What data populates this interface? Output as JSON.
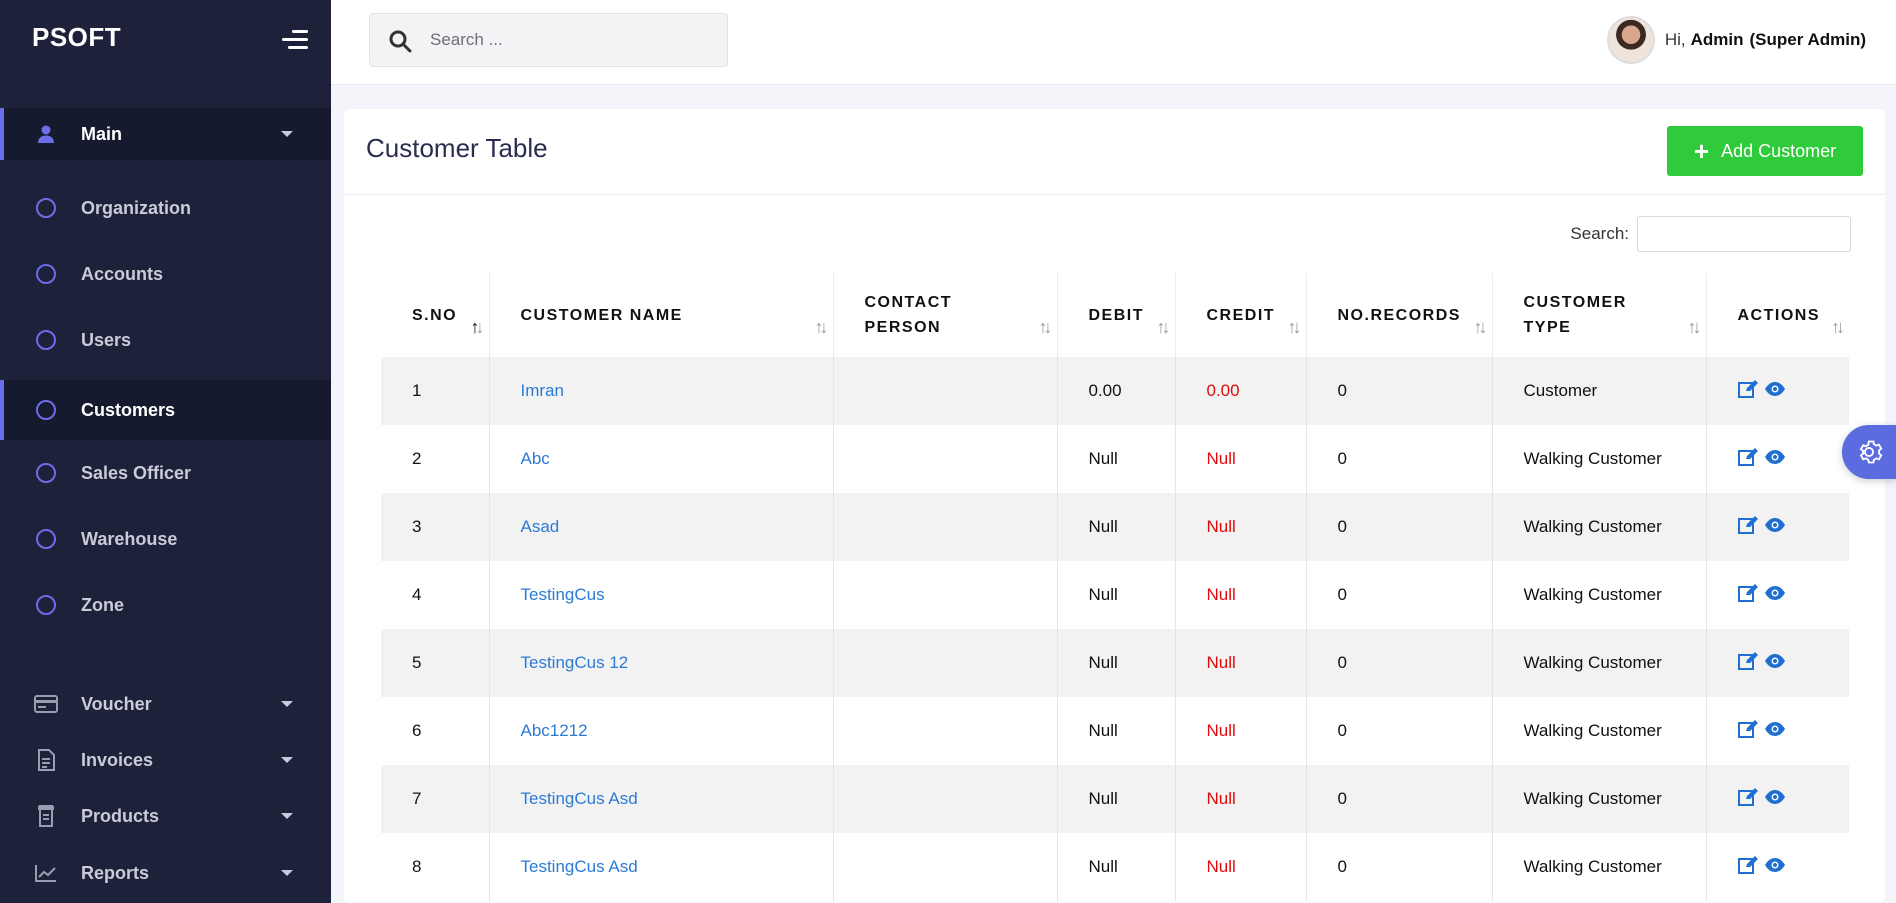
{
  "sidebar": {
    "brand": "PSOFT",
    "main_label": "Main",
    "items": [
      {
        "label": "Organization"
      },
      {
        "label": "Accounts"
      },
      {
        "label": "Users"
      },
      {
        "label": "Customers",
        "active": true
      },
      {
        "label": "Sales Officer"
      },
      {
        "label": "Warehouse"
      },
      {
        "label": "Zone"
      }
    ],
    "groups": [
      {
        "label": "Voucher",
        "icon": "voucher-icon"
      },
      {
        "label": "Invoices",
        "icon": "invoice-icon"
      },
      {
        "label": "Products",
        "icon": "product-icon"
      },
      {
        "label": "Reports",
        "icon": "chart-icon"
      }
    ]
  },
  "topbar": {
    "search_placeholder": "Search ...",
    "greeting": "Hi,",
    "user_name": "Admin",
    "user_role": "(Super Admin)"
  },
  "card": {
    "title": "Customer Table",
    "add_button": "Add Customer",
    "search_label": "Search:"
  },
  "table": {
    "columns": [
      "S.NO",
      "CUSTOMER NAME",
      "CONTACT PERSON",
      "DEBIT",
      "CREDIT",
      "NO.RECORDS",
      "CUSTOMER TYPE",
      "ACTIONS"
    ],
    "rows": [
      {
        "sno": "1",
        "name": "Imran",
        "contact": "",
        "debit": "0.00",
        "credit": "0.00",
        "records": "0",
        "type": "Customer"
      },
      {
        "sno": "2",
        "name": "Abc",
        "contact": "",
        "debit": "Null",
        "credit": "Null",
        "records": "0",
        "type": "Walking Customer"
      },
      {
        "sno": "3",
        "name": "Asad",
        "contact": "",
        "debit": "Null",
        "credit": "Null",
        "records": "0",
        "type": "Walking Customer"
      },
      {
        "sno": "4",
        "name": "TestingCus",
        "contact": "",
        "debit": "Null",
        "credit": "Null",
        "records": "0",
        "type": "Walking Customer"
      },
      {
        "sno": "5",
        "name": "TestingCus 12",
        "contact": "",
        "debit": "Null",
        "credit": "Null",
        "records": "0",
        "type": "Walking Customer"
      },
      {
        "sno": "6",
        "name": "Abc1212",
        "contact": "",
        "debit": "Null",
        "credit": "Null",
        "records": "0",
        "type": "Walking Customer"
      },
      {
        "sno": "7",
        "name": "TestingCus Asd",
        "contact": "",
        "debit": "Null",
        "credit": "Null",
        "records": "0",
        "type": "Walking Customer"
      },
      {
        "sno": "8",
        "name": "TestingCus Asd",
        "contact": "",
        "debit": "Null",
        "credit": "Null",
        "records": "0",
        "type": "Walking Customer"
      }
    ]
  },
  "colors": {
    "sidebar_bg": "#1d2139",
    "accent": "#6a6ee8",
    "add_button": "#2fcb3a",
    "link": "#2b7bd6",
    "credit_text": "#e00b0b"
  }
}
